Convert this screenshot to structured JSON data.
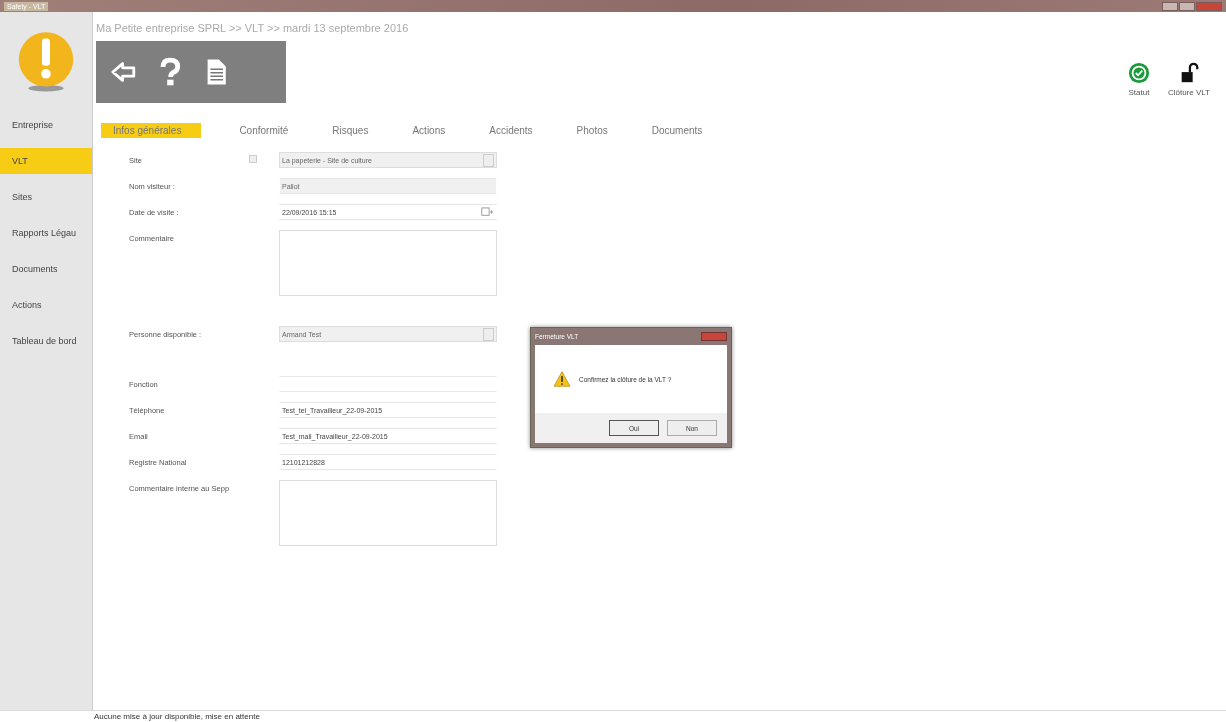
{
  "window": {
    "title": "Safety - VLT"
  },
  "sidebar": {
    "items": [
      {
        "label": "Entreprise",
        "selected": false
      },
      {
        "label": "VLT",
        "selected": true
      },
      {
        "label": "Sites",
        "selected": false
      },
      {
        "label": "Rapports Légau",
        "selected": false
      },
      {
        "label": "Documents",
        "selected": false
      },
      {
        "label": "Actions",
        "selected": false
      },
      {
        "label": "Tableau de bord",
        "selected": false
      }
    ]
  },
  "breadcrumb": "Ma Petite entreprise SPRL >> VLT >> mardi 13 septembre 2016",
  "top_actions": [
    {
      "label": "Statut",
      "kind": "status"
    },
    {
      "label": "Clôture VLT",
      "kind": "lock"
    }
  ],
  "tabs": [
    {
      "label": "Infos générales",
      "selected": true
    },
    {
      "label": "Conformité",
      "selected": false
    },
    {
      "label": "Risques",
      "selected": false
    },
    {
      "label": "Actions",
      "selected": false
    },
    {
      "label": "Accidents",
      "selected": false
    },
    {
      "label": "Photos",
      "selected": false
    },
    {
      "label": "Documents",
      "selected": false
    }
  ],
  "form": [
    {
      "label": "Site",
      "kind": "select",
      "value": "La papeterie - Site de culture",
      "disabled": true,
      "flag": true
    },
    {
      "label": "Nom visiteur :",
      "kind": "text",
      "value": "Pallot",
      "disabled": true
    },
    {
      "label": "Date de visite :",
      "kind": "date",
      "value": "22/09/2016 15:15",
      "disabled": false
    },
    {
      "label": "Commentaire",
      "kind": "textarea",
      "disabled": false
    },
    {
      "label": "Personne disponible :",
      "kind": "select",
      "value": "Armand Test",
      "disabled": true
    },
    {
      "label": "Fonction",
      "kind": "text",
      "disabled": false
    },
    {
      "label": "Téléphone",
      "kind": "text",
      "value": "Test_tel_Travailleur_22-09-2015",
      "disabled": false
    },
    {
      "label": "Email",
      "kind": "text",
      "value": "Test_mail_Travailleur_22-09-2015",
      "disabled": false
    },
    {
      "label": "Registre National",
      "kind": "text",
      "value": "12101212828",
      "disabled": false
    },
    {
      "label": "Commentaire interne au Sepp",
      "kind": "textarea",
      "disabled": false
    }
  ],
  "dialog": {
    "title": "Fermeture VLT",
    "message": "Confirmez la clôture de la VLT ?",
    "buttons": [
      "Oui",
      "Non"
    ]
  },
  "status_bar": "Aucune mise à jour disponible, mise en attente"
}
